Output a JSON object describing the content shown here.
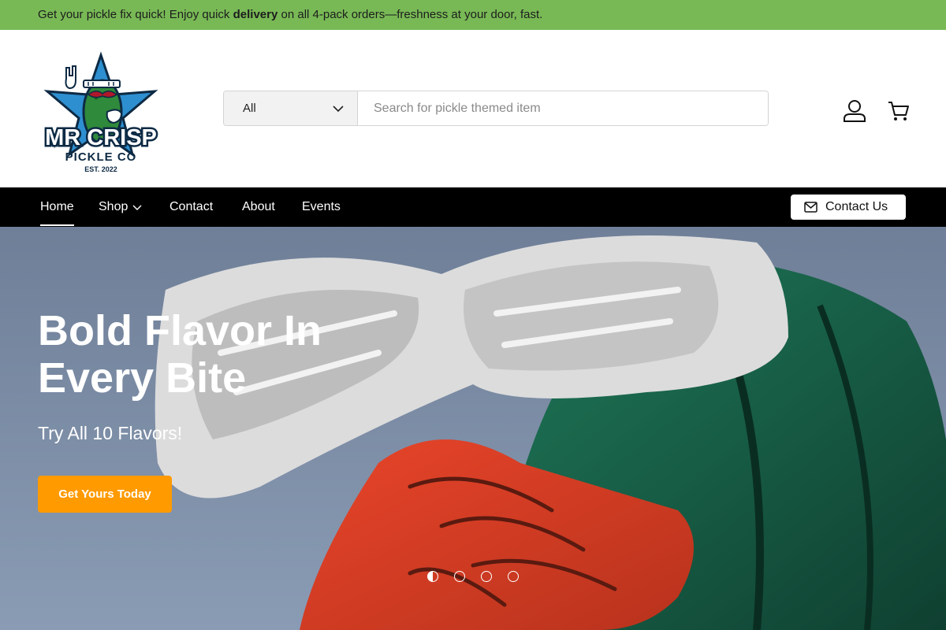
{
  "announcement": {
    "before": "Get your pickle fix quick! Enjoy quick ",
    "bold": "delivery",
    "after": " on all 4-pack orders—freshness at your door, fast."
  },
  "logo": {
    "line1": "MR CRISP",
    "line2": "PICKLE CO",
    "line3": "EST. 2022"
  },
  "search": {
    "category": "All",
    "placeholder": "Search for pickle themed item"
  },
  "header_icons": [
    "account-icon",
    "cart-icon"
  ],
  "nav": {
    "items": [
      {
        "label": "Home",
        "active": true
      },
      {
        "label": "Shop",
        "has_dropdown": true
      },
      {
        "label": "Contact"
      },
      {
        "label": "About"
      },
      {
        "label": "Events"
      }
    ],
    "contact_button": "Contact Us"
  },
  "hero": {
    "title": "Bold Flavor In Every Bite",
    "subtitle": "Try All 10 Flavors!",
    "cta": "Get Yours Today",
    "slide_count": 4,
    "active_slide": 1
  },
  "colors": {
    "announcement_bg": "#78b955",
    "nav_bg": "#000000",
    "cta_bg": "#ff9a00",
    "logo_star": "#2e8fd0",
    "logo_pickle": "#2f8a3b"
  }
}
